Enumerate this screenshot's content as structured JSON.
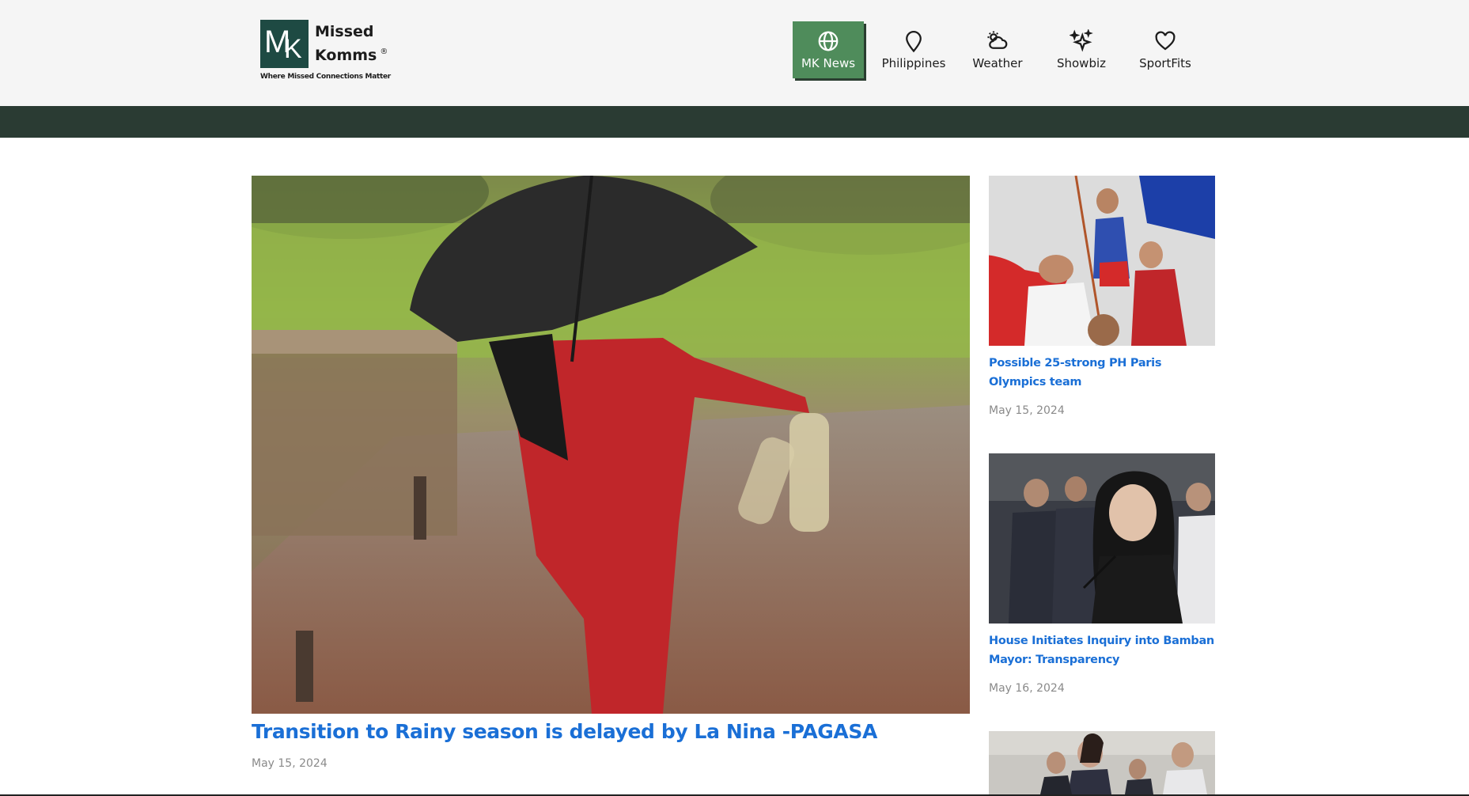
{
  "brand": {
    "logo_m": "M",
    "logo_k": "K",
    "name_line1": "Missed",
    "name_line2": "Komms",
    "registered": "®",
    "tagline": "Where Missed Connections Matter"
  },
  "nav": {
    "items": [
      {
        "label": "MK News",
        "icon": "globe-icon",
        "active": true
      },
      {
        "label": "Philippines",
        "icon": "location-pin-icon"
      },
      {
        "label": "Weather",
        "icon": "weather-cloud-sun-icon"
      },
      {
        "label": "Showbiz",
        "icon": "sparkles-icon"
      },
      {
        "label": "SportFits",
        "icon": "heart-icon"
      }
    ]
  },
  "colors": {
    "header_bg": "#f5f5f5",
    "band": "#2a3b33",
    "active_nav": "#4f8c5b",
    "link": "#1a6fd6",
    "date": "#8a8a8a",
    "logo_bg": "#1e4a43"
  },
  "feature": {
    "title": "Transition to Rainy season is delayed by La Nina -PAGASA",
    "date": "May 15, 2024",
    "image": "woman-with-umbrella-in-rain-photo"
  },
  "sidebar": {
    "articles": [
      {
        "title": "Possible 25-strong PH Paris Olympics team",
        "date": "May 15, 2024",
        "image": "olympic-athletes-photo"
      },
      {
        "title": "House Initiates Inquiry into Bamban Mayor: Transparency",
        "date": "May 16, 2024",
        "image": "hearing-woman-photo"
      },
      {
        "title": "",
        "date": "",
        "image": "people-in-office-photo"
      }
    ]
  }
}
